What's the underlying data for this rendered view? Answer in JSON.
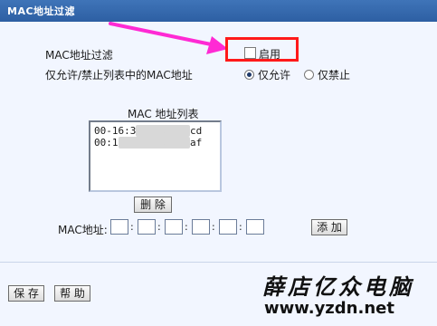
{
  "window": {
    "title": "MAC地址过滤"
  },
  "filter": {
    "label": "MAC地址过滤",
    "enable_label": "启用",
    "enabled": false,
    "mode_label": "仅允许/禁止列表中的MAC地址",
    "options": [
      {
        "label": "仅允许",
        "selected": true
      },
      {
        "label": "仅禁止",
        "selected": false
      }
    ]
  },
  "list": {
    "title": "MAC 地址列表",
    "entries": [
      {
        "prefix": "00-16:3",
        "suffix": "cd"
      },
      {
        "prefix": "00:1",
        "suffix": "af"
      }
    ]
  },
  "buttons": {
    "delete": "删 除",
    "add": "添 加",
    "save": "保 存",
    "help": "帮 助"
  },
  "mac_input": {
    "label": "MAC地址:",
    "fields": [
      "",
      "",
      "",
      "",
      "",
      ""
    ]
  },
  "watermark": {
    "line1": "薛店亿众电脑",
    "line2": "www.yzdn.net"
  },
  "colors": {
    "title_bar": "#2d5fa3",
    "highlight": "#ff1a1a",
    "arrow": "#ff2ad4"
  }
}
